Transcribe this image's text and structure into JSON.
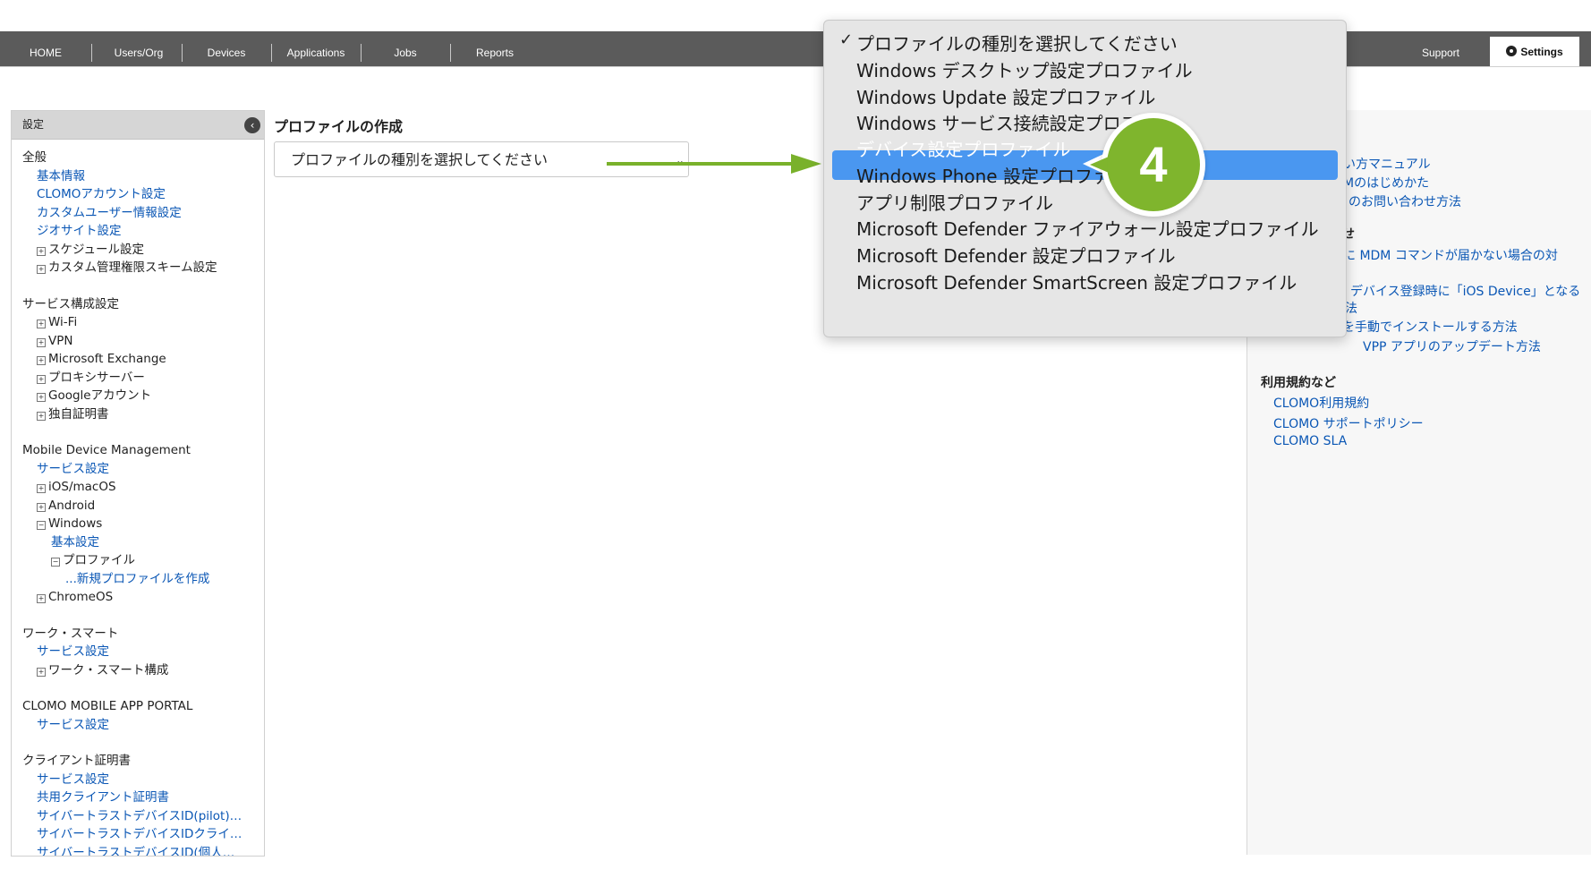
{
  "nav": {
    "items": [
      "HOME",
      "Users/Org",
      "Devices",
      "Applications",
      "Jobs",
      "Reports"
    ],
    "support": "Support",
    "settings": "Settings"
  },
  "sidebar": {
    "header": "設定",
    "collapse_glyph": "‹",
    "sections": [
      {
        "title": "全般",
        "rows": [
          {
            "text": "基本情報",
            "indent": 1,
            "link": true
          },
          {
            "text": "CLOMOアカウント設定",
            "indent": 1,
            "link": true
          },
          {
            "text": "カスタムユーザー情報設定",
            "indent": 1,
            "link": true
          },
          {
            "text": "ジオサイト設定",
            "indent": 1,
            "link": true
          },
          {
            "text": "スケジュール設定",
            "indent": 1,
            "box": "+"
          },
          {
            "text": "カスタム管理権限スキーム設定",
            "indent": 1,
            "box": "+"
          }
        ]
      },
      {
        "title": "サービス構成設定",
        "rows": [
          {
            "text": "Wi-Fi",
            "indent": 1,
            "box": "+"
          },
          {
            "text": "VPN",
            "indent": 1,
            "box": "+"
          },
          {
            "text": "Microsoft Exchange",
            "indent": 1,
            "box": "+"
          },
          {
            "text": "プロキシサーバー",
            "indent": 1,
            "box": "+"
          },
          {
            "text": "Googleアカウント",
            "indent": 1,
            "box": "+"
          },
          {
            "text": "独自証明書",
            "indent": 1,
            "box": "+"
          }
        ]
      },
      {
        "title": "Mobile Device Management",
        "rows": [
          {
            "text": "サービス設定",
            "indent": 1,
            "link": true
          },
          {
            "text": "iOS/macOS",
            "indent": 1,
            "box": "+"
          },
          {
            "text": "Android",
            "indent": 1,
            "box": "+"
          },
          {
            "text": "Windows",
            "indent": 1,
            "box": "−"
          },
          {
            "text": "基本設定",
            "indent": 2,
            "link": true
          },
          {
            "text": "プロファイル",
            "indent": 2,
            "box": "−"
          },
          {
            "text": "...新規プロファイルを作成",
            "indent": 3,
            "link": true
          },
          {
            "text": "ChromeOS",
            "indent": 1,
            "box": "+"
          }
        ]
      },
      {
        "title": "ワーク・スマート",
        "rows": [
          {
            "text": "サービス設定",
            "indent": 1,
            "link": true
          },
          {
            "text": "ワーク・スマート構成",
            "indent": 1,
            "box": "+"
          }
        ]
      },
      {
        "title": "CLOMO MOBILE APP PORTAL",
        "rows": [
          {
            "text": "サービス設定",
            "indent": 1,
            "link": true
          }
        ]
      },
      {
        "title": "クライアント証明書",
        "rows": [
          {
            "text": "サービス設定",
            "indent": 1,
            "link": true
          },
          {
            "text": "共用クライアント証明書",
            "indent": 1,
            "link": true
          },
          {
            "text": "サイバートラストデバイスID(pilot)…",
            "indent": 1,
            "link": true
          },
          {
            "text": "サイバートラストデバイスIDクライ…",
            "indent": 1,
            "link": true
          },
          {
            "text": "サイバートラストデバイスID(個人…",
            "indent": 1,
            "link": true
          }
        ]
      }
    ]
  },
  "main": {
    "title": "プロファイルの作成",
    "select_value": "プロファイルの種別を選択してください",
    "select_chevron": "⌄"
  },
  "dropdown": {
    "check_glyph": "✓",
    "options": [
      "プロファイルの種別を選択してください",
      "Windows デスクトップ設定プロファイル",
      "Windows Update 設定プロファイル",
      "Windows サービス接続設定プロフ",
      "デバイス設定プロファイル",
      "Windows Phone 設定プロファイル",
      "アプリ制限プロファイル",
      "Microsoft Defender ファイアウォール設定プロファイル",
      "Microsoft Defender 設定プロファイル",
      "Microsoft Defender SmartScreen 設定プロファイル"
    ],
    "selected_index": 0,
    "highlighted_index": 4
  },
  "step_badge": "4",
  "right_panel": {
    "lines": [
      {
        "text": "い方マニュアル",
        "type": "link"
      },
      {
        "text": "Mのはじめかた",
        "type": "link"
      },
      {
        "text": "のお問い合わせ方法",
        "type": "link"
      },
      {
        "text": "合せ",
        "type": "head"
      },
      {
        "text": "に MDM コマンドが届かない場合の対",
        "type": "link"
      },
      {
        "text": "デバイス登録時に「iOS Device」となる",
        "type": "link"
      },
      {
        "text": "法",
        "type": "link"
      },
      {
        "text": "を手動でインストールする方法",
        "type": "link"
      },
      {
        "text": "VPP アプリのアップデート方法",
        "type": "link"
      },
      {
        "text": "利用規約など",
        "type": "head"
      },
      {
        "text": "CLOMO利用規約",
        "type": "link"
      },
      {
        "text": "CLOMO サポートポリシー",
        "type": "link"
      },
      {
        "text": "CLOMO SLA",
        "type": "link"
      }
    ]
  }
}
